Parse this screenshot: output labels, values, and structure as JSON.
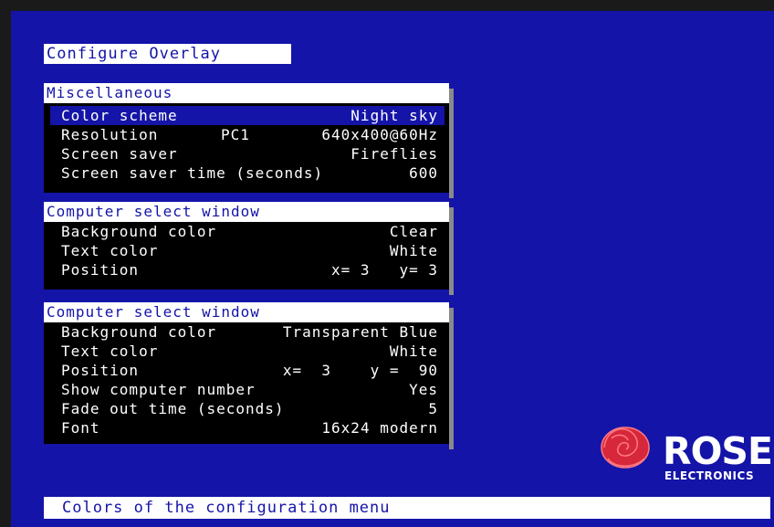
{
  "title": "Configure Overlay",
  "misc": {
    "header": "Miscellaneous",
    "color_scheme_label": "Color scheme",
    "color_scheme_value": "Night sky",
    "resolution_label": "Resolution",
    "resolution_mid": "PC1",
    "resolution_value": "640x400@60Hz",
    "saver_label": "Screen saver",
    "saver_value": "Fireflies",
    "saver_time_label": "Screen saver time (seconds)",
    "saver_time_value": "600"
  },
  "csw1": {
    "header": "Computer select window",
    "bg_label": "Background color",
    "bg_value": "Clear",
    "text_label": "Text color",
    "text_value": "White",
    "pos_label": "Position",
    "pos_value": "x= 3   y= 3"
  },
  "csw2": {
    "header": "Computer select window",
    "bg_label": "Background color",
    "bg_value": "Transparent Blue",
    "text_label": "Text color",
    "text_value": "White",
    "pos_label": "Position",
    "pos_value": "x=  3    y =  90",
    "num_label": "Show computer number",
    "num_value": "Yes",
    "fade_label": "Fade out time (seconds)",
    "fade_value": "5",
    "font_label": "Font",
    "font_value": "16x24 modern"
  },
  "logo": {
    "name": "ROSE",
    "sub": "ELECTRONICS",
    "rose_color": "#d6283a"
  },
  "status": "Colors of the configuration menu",
  "colors": {
    "screen_bg": "#1414a8",
    "panel_bg": "#000000",
    "header_bg": "#ffffff"
  }
}
